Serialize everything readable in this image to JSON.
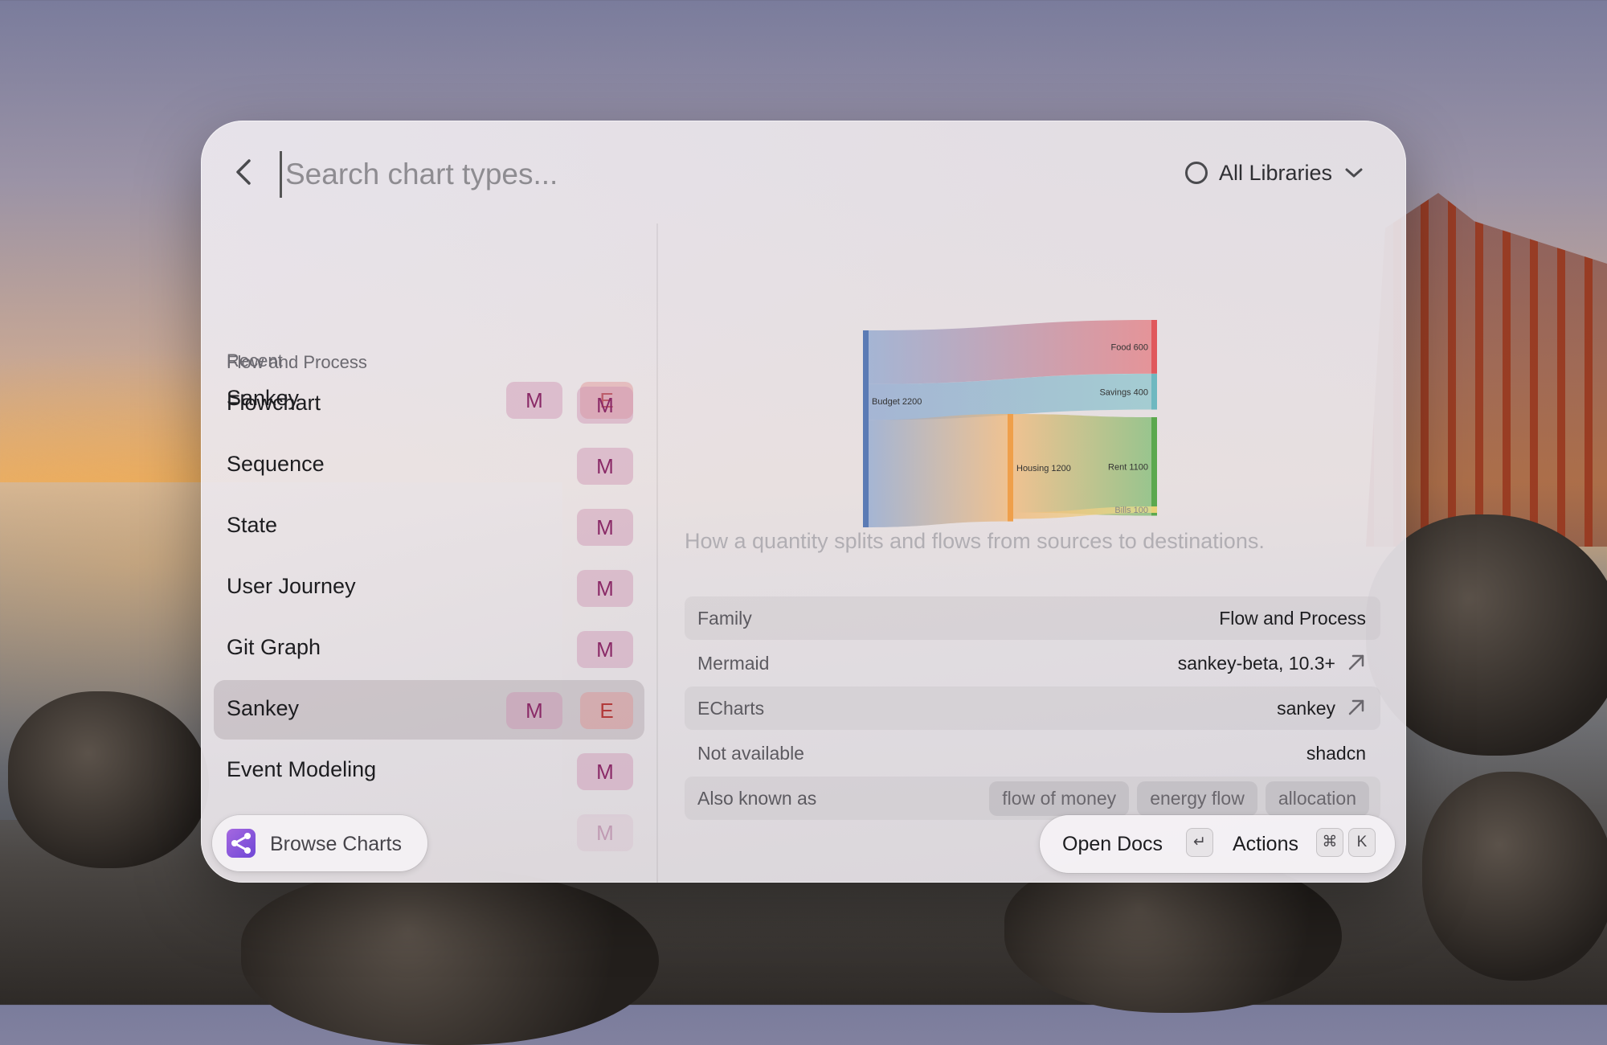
{
  "search": {
    "placeholder": "Search chart types..."
  },
  "library_selector": {
    "label": "All Libraries"
  },
  "sections": {
    "recent": "Recent",
    "flow": "Flow and Process"
  },
  "recent_items": [
    {
      "name": "Sankey",
      "badges": [
        "M",
        "E"
      ]
    }
  ],
  "flow_items": [
    {
      "name": "Flowchart",
      "badges": [
        "M"
      ]
    },
    {
      "name": "Sequence",
      "badges": [
        "M"
      ]
    },
    {
      "name": "State",
      "badges": [
        "M"
      ]
    },
    {
      "name": "User Journey",
      "badges": [
        "M"
      ]
    },
    {
      "name": "Git Graph",
      "badges": [
        "M"
      ]
    },
    {
      "name": "Sankey",
      "badges": [
        "M",
        "E"
      ],
      "selected": true
    },
    {
      "name": "Event Modeling",
      "badges": [
        "M"
      ]
    },
    {
      "name": "",
      "badges": [
        "M"
      ]
    }
  ],
  "browse_button": {
    "label": "Browse Charts"
  },
  "preview": {
    "description": "How a quantity splits and flows from sources to destinations.",
    "chart_data": {
      "type": "sankey",
      "nodes": [
        {
          "name": "Budget",
          "value": 2200,
          "label": "Budget 2200",
          "color": "#5b7bb5"
        },
        {
          "name": "Food",
          "value": 600,
          "label": "Food 600",
          "color": "#e0585c"
        },
        {
          "name": "Savings",
          "value": 400,
          "label": "Savings 400",
          "color": "#6fb8c0"
        },
        {
          "name": "Housing",
          "value": 1200,
          "label": "Housing 1200",
          "color": "#ef9f4a"
        },
        {
          "name": "Rent",
          "value": 1100,
          "label": "Rent 1100",
          "color": "#5ba84e"
        },
        {
          "name": "Bills",
          "value": 100,
          "label": "Bills 100",
          "color": "#e7d278"
        }
      ],
      "links": [
        {
          "source": "Budget",
          "target": "Food",
          "value": 600
        },
        {
          "source": "Budget",
          "target": "Savings",
          "value": 400
        },
        {
          "source": "Budget",
          "target": "Housing",
          "value": 1200
        },
        {
          "source": "Housing",
          "target": "Rent",
          "value": 1100
        },
        {
          "source": "Housing",
          "target": "Bills",
          "value": 100
        }
      ]
    }
  },
  "properties": {
    "family": {
      "key": "Family",
      "value": "Flow and Process"
    },
    "mermaid": {
      "key": "Mermaid",
      "value": "sankey-beta, 10.3+"
    },
    "echarts": {
      "key": "ECharts",
      "value": "sankey"
    },
    "not_available": {
      "key": "Not available",
      "value": "shadcn"
    },
    "aka": {
      "key": "Also known as",
      "chips": [
        "flow of money",
        "energy flow",
        "allocation"
      ]
    }
  },
  "footer_actions": {
    "open_docs": "Open Docs",
    "open_docs_key": "↵",
    "actions": "Actions",
    "actions_keys": [
      "⌘",
      "K"
    ]
  },
  "colors": {
    "mermaid_badge": "#8a2a67",
    "echarts_badge": "#b23a3a",
    "accent_icon": "#8b5cf6"
  }
}
